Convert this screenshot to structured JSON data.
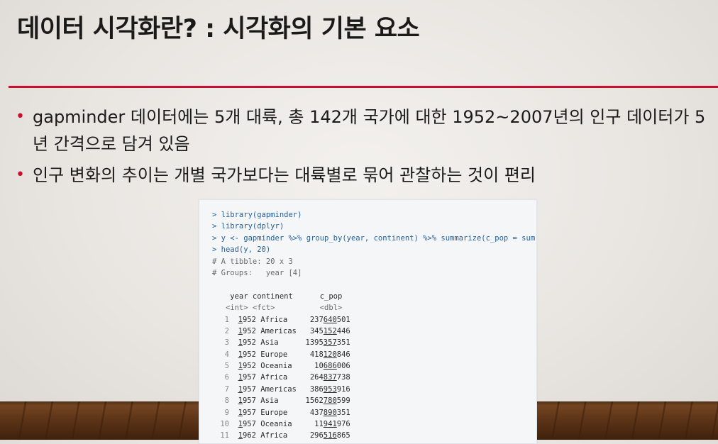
{
  "slide": {
    "title": "데이터 시각화란? : 시각화의 기본 요소",
    "bullets": [
      "gapminder 데이터에는 5개 대륙, 총 142개 국가에 대한 1952~2007년의 인구 데이터가 5년 간격으로 담겨 있음",
      "인구 변화의 추이는 개별 국가보다는 대륙별로 묶어 관찰하는 것이 편리"
    ]
  },
  "console": {
    "commands": [
      "> library(gapminder)",
      "> library(dplyr)",
      "> y <- gapminder %>% group_by(year, continent) %>% summarize(c_pop = sum(pop))",
      "> head(y, 20)"
    ],
    "comments": [
      "# A tibble: 20 x 3",
      "# Groups:   year [4]"
    ],
    "header": "    year continent      c_pop",
    "types": "   <int> <fct>          <dbl>",
    "rows": [
      {
        "i": "1",
        "year": "1952",
        "continent": "Africa",
        "pop_a": "237",
        "pop_b": "640",
        "pop_c": "501"
      },
      {
        "i": "2",
        "year": "1952",
        "continent": "Americas",
        "pop_a": "345",
        "pop_b": "152",
        "pop_c": "446"
      },
      {
        "i": "3",
        "year": "1952",
        "continent": "Asia",
        "pop_a": "1395",
        "pop_b": "357",
        "pop_c": "351"
      },
      {
        "i": "4",
        "year": "1952",
        "continent": "Europe",
        "pop_a": "418",
        "pop_b": "120",
        "pop_c": "846"
      },
      {
        "i": "5",
        "year": "1952",
        "continent": "Oceania",
        "pop_a": "10",
        "pop_b": "686",
        "pop_c": "006"
      },
      {
        "i": "6",
        "year": "1957",
        "continent": "Africa",
        "pop_a": "264",
        "pop_b": "837",
        "pop_c": "738"
      },
      {
        "i": "7",
        "year": "1957",
        "continent": "Americas",
        "pop_a": "386",
        "pop_b": "953",
        "pop_c": "916"
      },
      {
        "i": "8",
        "year": "1957",
        "continent": "Asia",
        "pop_a": "1562",
        "pop_b": "780",
        "pop_c": "599"
      },
      {
        "i": "9",
        "year": "1957",
        "continent": "Europe",
        "pop_a": "437",
        "pop_b": "890",
        "pop_c": "351"
      },
      {
        "i": "10",
        "year": "1957",
        "continent": "Oceania",
        "pop_a": "11",
        "pop_b": "941",
        "pop_c": "976"
      },
      {
        "i": "11",
        "year": "1962",
        "continent": "Africa",
        "pop_a": "296",
        "pop_b": "516",
        "pop_c": "865"
      }
    ]
  },
  "colors": {
    "accent": "#c8102e",
    "command": "#1f5f9e"
  }
}
